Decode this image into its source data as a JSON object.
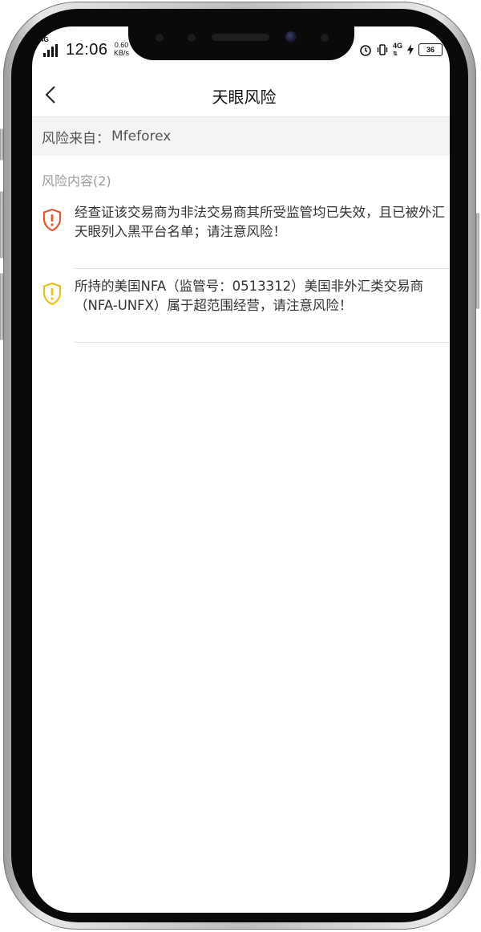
{
  "status_bar": {
    "network_left": "4G",
    "time": "12:06",
    "speed_value": "0.60",
    "speed_unit": "KB/s",
    "network_right": "4G",
    "battery": "36"
  },
  "header": {
    "title": "天眼风险"
  },
  "source": {
    "label": "风险来自：",
    "value": "Mfeforex"
  },
  "section": {
    "title": "风险内容(2)"
  },
  "risks": [
    {
      "level_color": "#e8542c",
      "text": "经查证该交易商为非法交易商其所受监管均已失效，且已被外汇天眼列入黑平台名单；请注意风险！"
    },
    {
      "level_color": "#e6c21a",
      "text": "所持的美国NFA（监管号：0513312）美国非外汇类交易商（NFA-UNFX）属于超范围经营，请注意风险！"
    }
  ]
}
